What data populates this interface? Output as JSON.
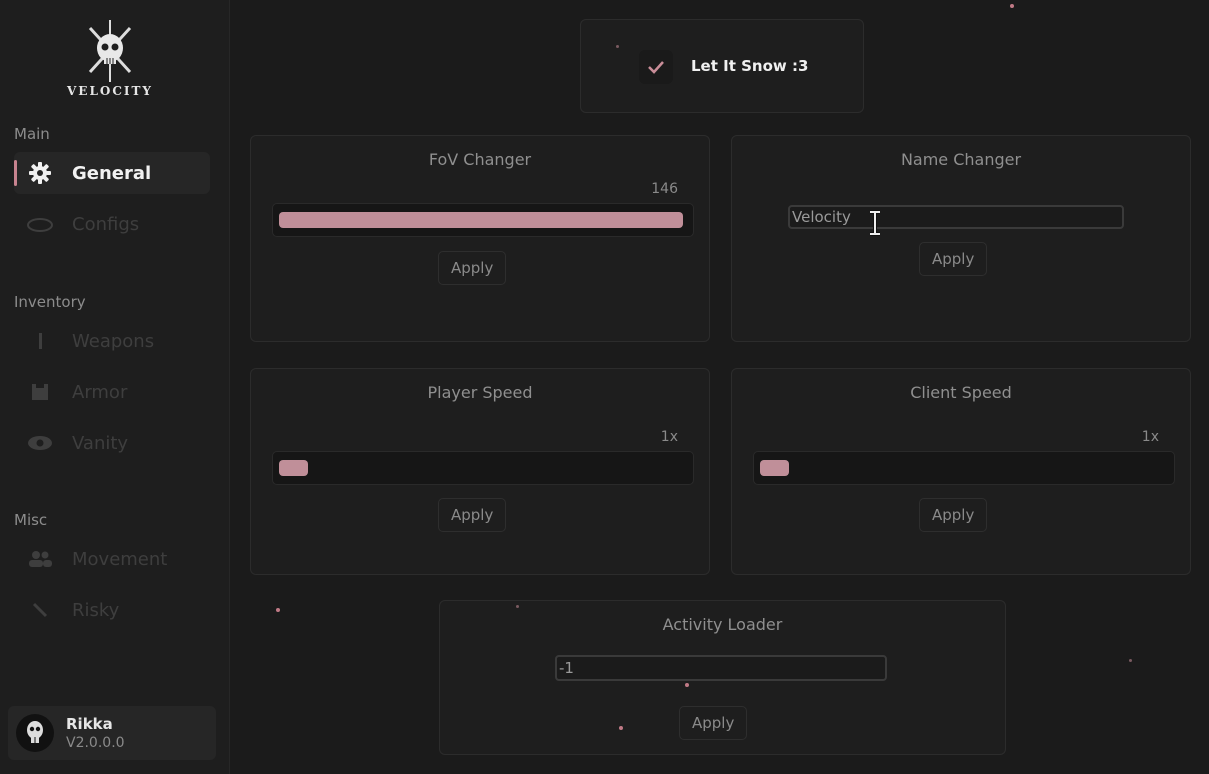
{
  "app": {
    "logo_text": "VELOCITY"
  },
  "sidebar": {
    "sections": [
      {
        "label": "Main"
      },
      {
        "label": "Inventory"
      },
      {
        "label": "Misc"
      }
    ],
    "items": [
      {
        "label": "General",
        "icon": "gear-icon",
        "active": true
      },
      {
        "label": "Configs",
        "icon": "cloud-icon"
      },
      {
        "label": "Weapons",
        "icon": "weapon-icon"
      },
      {
        "label": "Armor",
        "icon": "armor-icon"
      },
      {
        "label": "Vanity",
        "icon": "eye-icon"
      },
      {
        "label": "Movement",
        "icon": "users-icon"
      },
      {
        "label": "Risky",
        "icon": "slash-icon"
      }
    ]
  },
  "user": {
    "name": "Rikka",
    "version": "V2.0.0.0"
  },
  "snow_toggle": {
    "label": "Let It Snow :3",
    "checked": true
  },
  "fov_changer": {
    "title": "FoV Changer",
    "value_label": "146",
    "fill_fraction": 0.99,
    "apply_label": "Apply"
  },
  "name_changer": {
    "title": "Name Changer",
    "value": "Velocity",
    "apply_label": "Apply"
  },
  "player_speed": {
    "title": "Player Speed",
    "value_label": "1x",
    "fill_fraction": 0.07,
    "apply_label": "Apply"
  },
  "client_speed": {
    "title": "Client Speed",
    "value_label": "1x",
    "fill_fraction": 0.07,
    "apply_label": "Apply"
  },
  "activity_loader": {
    "title": "Activity Loader",
    "value": "-1",
    "apply_label": "Apply"
  },
  "colors": {
    "accent": "#c08f99",
    "background": "#1b1b1b",
    "card": "#1e1e1e"
  }
}
